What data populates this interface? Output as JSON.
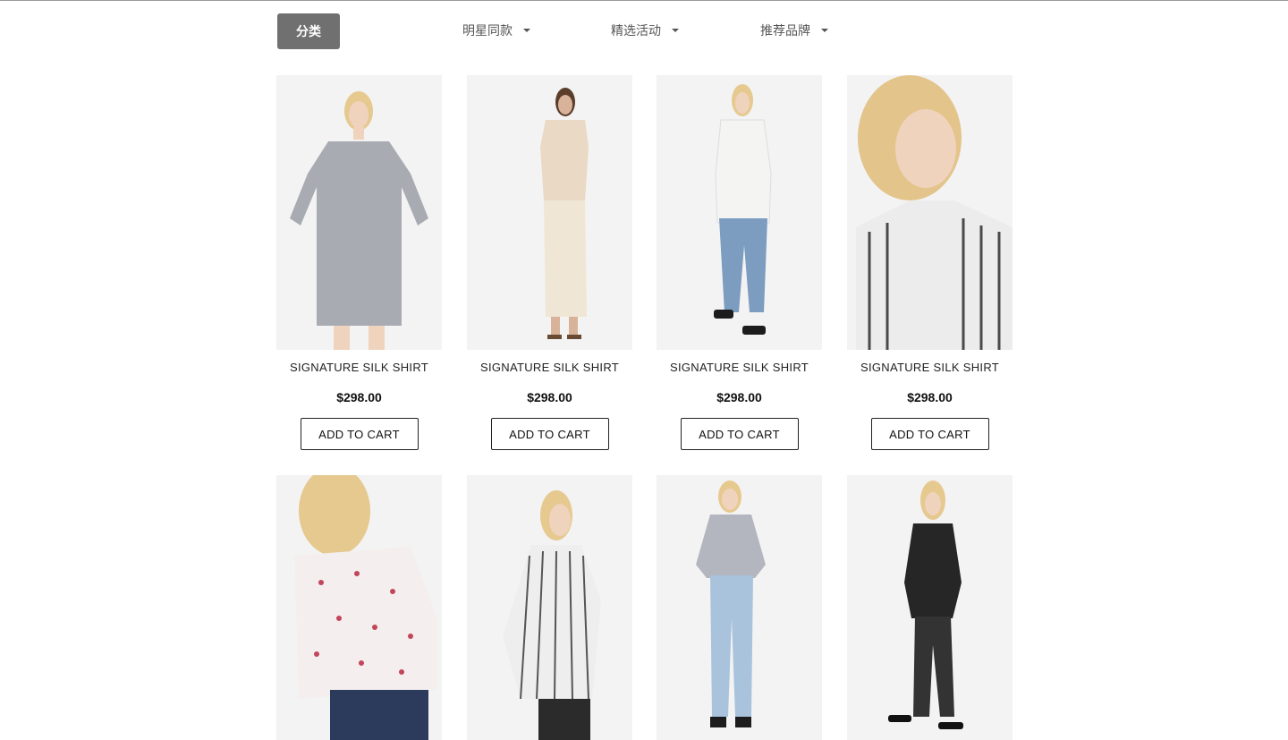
{
  "toolbar": {
    "category_label": "分类",
    "menus": [
      {
        "label": "明星同款"
      },
      {
        "label": "精选活动"
      },
      {
        "label": "推荐品牌"
      }
    ]
  },
  "products": [
    {
      "name": "SIGNATURE SILK SHIRT",
      "price": "$298.00",
      "button": "ADD TO CART",
      "top_color": "#a9abb3",
      "bottom_color": "#a9abb3"
    },
    {
      "name": "SIGNATURE SILK SHIRT",
      "price": "$298.00",
      "button": "ADD TO CART",
      "top_color": "#ead9c4",
      "bottom_color": "#efe6d6"
    },
    {
      "name": "SIGNATURE SILK SHIRT",
      "price": "$298.00",
      "button": "ADD TO CART",
      "top_color": "#f4f4f2",
      "bottom_color": "#7c9cc0"
    },
    {
      "name": "SIGNATURE SILK SHIRT",
      "price": "$298.00",
      "button": "ADD TO CART",
      "top_color": "#ececec",
      "bottom_color": "#ececec"
    },
    {
      "top_color": "#f5eeee",
      "bottom_color": "#2c3a5c"
    },
    {
      "top_color": "#eeeeee",
      "bottom_color": "#2b2b2b"
    },
    {
      "top_color": "#b3b6bf",
      "bottom_color": "#a9c3dc"
    },
    {
      "top_color": "#262626",
      "bottom_color": "#333333"
    }
  ]
}
